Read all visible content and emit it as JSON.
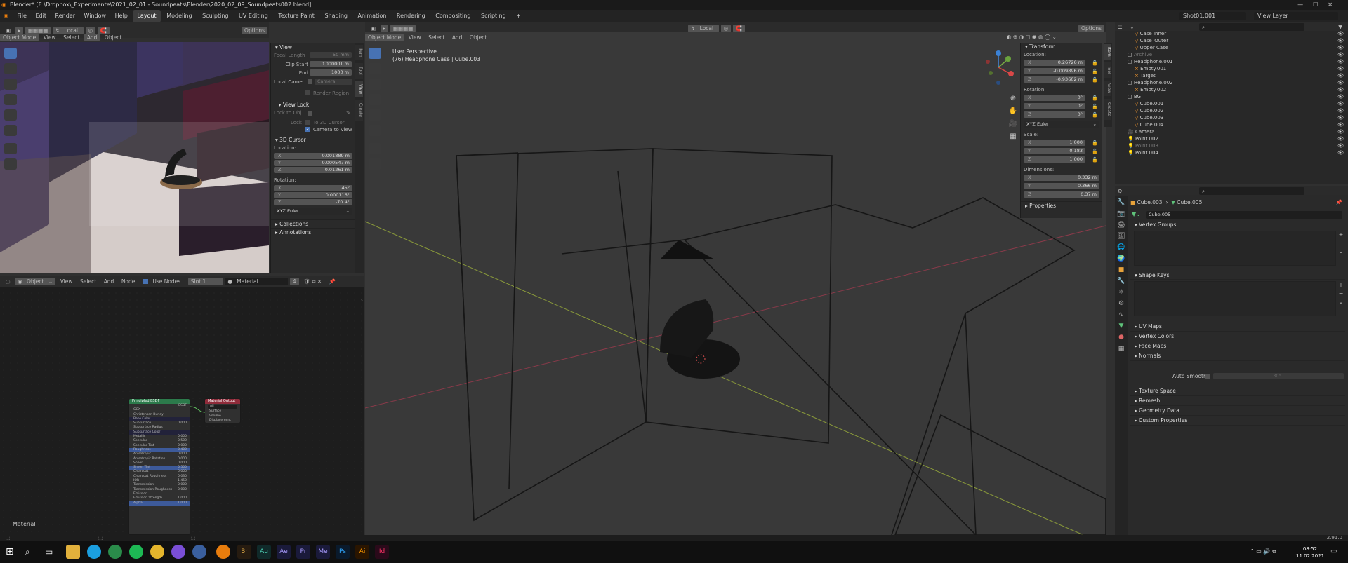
{
  "title": "Blender* [E:\\Dropbox\\_Experimente\\2021_02_01 - Soundpeats\\Blender\\2020_02_09_Soundpeats002.blend]",
  "menu": [
    "File",
    "Edit",
    "Render",
    "Window",
    "Help"
  ],
  "workspaces": [
    "Layout",
    "Modeling",
    "Sculpting",
    "UV Editing",
    "Texture Paint",
    "Shading",
    "Animation",
    "Rendering",
    "Compositing",
    "Scripting"
  ],
  "active_workspace": "Layout",
  "scene": "Shot01.001",
  "view_layer": "View Layer",
  "left_viewport": {
    "mode": "Object Mode",
    "menu": [
      "View",
      "Select",
      "Add",
      "Object"
    ],
    "orientation": "Local",
    "options": "Options",
    "npanel": {
      "view_header": "View",
      "focal_length_label": "Focal Length",
      "focal_length": "50 mm",
      "clip_start_label": "Clip Start",
      "clip_start": "0.000001 m",
      "end_label": "End",
      "end": "1000 m",
      "local_camera_label": "Local Came...",
      "local_camera_value": "Camera",
      "render_region": "Render Region",
      "view_lock_header": "View Lock",
      "lock_to_obj": "Lock to Obj...",
      "lock_label": "Lock",
      "to_3d_cursor": "To 3D Cursor",
      "camera_to_view": "Camera to View",
      "cursor_header": "3D Cursor",
      "location_label": "Location:",
      "loc_x": "-0.001889 m",
      "loc_y": "0.000547 m",
      "loc_z": "0.01261 m",
      "rotation_label": "Rotation:",
      "rot_x": "45°",
      "rot_y": "0.000116°",
      "rot_z": "-70.4°",
      "rot_mode": "XYZ Euler",
      "collections": "Collections",
      "annotations": "Annotations",
      "tabs": [
        "Item",
        "Tool",
        "View",
        "Create"
      ]
    }
  },
  "node_editor": {
    "type": "Object",
    "menu": [
      "View",
      "Select",
      "Add",
      "Node"
    ],
    "use_nodes": "Use Nodes",
    "slot": "Slot 1",
    "material": "Material",
    "users": "4",
    "corner_label": "Material",
    "bsdf": {
      "title": "Principled BSDF",
      "out": "BSDF",
      "rows": [
        "GGX",
        "Christensen-Burley",
        "Base Color",
        "Subsurface",
        "Subsurface Radius",
        "Subsurface Color",
        "Metallic",
        "Specular",
        "Specular Tint",
        "Roughness",
        "Anisotropic",
        "Anisotropic Rotation",
        "Sheen",
        "Sheen Tint",
        "Clearcoat",
        "Clearcoat Roughness",
        "IOR",
        "Transmission",
        "Transmission Roughness",
        "Emission",
        "Emission Strength",
        "Alpha"
      ],
      "vals": [
        "",
        "",
        "",
        "0.000",
        "",
        "",
        "0.000",
        "0.500",
        "0.000",
        "0.400",
        "0.000",
        "0.000",
        "0.000",
        "0.500",
        "0.000",
        "0.030",
        "1.450",
        "0.000",
        "0.000",
        "",
        "1.000",
        "1.000"
      ]
    },
    "output": {
      "title": "Material Output",
      "target": "All",
      "rows": [
        "Surface",
        "Volume",
        "Displacement"
      ]
    }
  },
  "main_viewport": {
    "mode": "Object Mode",
    "menu": [
      "View",
      "Select",
      "Add",
      "Object"
    ],
    "orientation": "Local",
    "options": "Options",
    "info_line1": "User Perspective",
    "info_line2": "(76) Headphone Case | Cube.003",
    "tabs": [
      "Item",
      "Tool",
      "View",
      "Create"
    ],
    "transform": {
      "header": "Transform",
      "location_label": "Location:",
      "loc": [
        "0.26726 m",
        "-0.009896 m",
        "-0.93602 m"
      ],
      "rotation_label": "Rotation:",
      "rot": [
        "0°",
        "0°",
        "0°"
      ],
      "rot_mode": "XYZ Euler",
      "scale_label": "Scale:",
      "scale": [
        "1.000",
        "0.183",
        "1.000"
      ],
      "dimensions_label": "Dimensions:",
      "dim": [
        "0.332 m",
        "0.366 m",
        "0.37 m"
      ],
      "properties": "Properties"
    }
  },
  "outliner": {
    "items": [
      {
        "name": "Case Inner",
        "indent": 2,
        "icon": "mesh"
      },
      {
        "name": "Case_Outer",
        "indent": 2,
        "icon": "mesh"
      },
      {
        "name": "Upper Case",
        "indent": 2,
        "icon": "mesh"
      },
      {
        "name": "Archive",
        "indent": 1,
        "icon": "collection",
        "dim": true
      },
      {
        "name": "Headphone.001",
        "indent": 1,
        "icon": "collection"
      },
      {
        "name": "Empty.001",
        "indent": 2,
        "icon": "empty"
      },
      {
        "name": "Target",
        "indent": 2,
        "icon": "empty"
      },
      {
        "name": "Headphone.002",
        "indent": 1,
        "icon": "collection"
      },
      {
        "name": "Empty.002",
        "indent": 2,
        "icon": "empty"
      },
      {
        "name": "BG",
        "indent": 1,
        "icon": "collection"
      },
      {
        "name": "Cube.001",
        "indent": 2,
        "icon": "mesh"
      },
      {
        "name": "Cube.002",
        "indent": 2,
        "icon": "mesh"
      },
      {
        "name": "Cube.003",
        "indent": 2,
        "icon": "mesh"
      },
      {
        "name": "Cube.004",
        "indent": 2,
        "icon": "mesh"
      },
      {
        "name": "Camera",
        "indent": 1,
        "icon": "camera"
      },
      {
        "name": "Point.002",
        "indent": 1,
        "icon": "light"
      },
      {
        "name": "Point.003",
        "indent": 1,
        "icon": "light",
        "dim": true
      },
      {
        "name": "Point.004",
        "indent": 1,
        "icon": "light"
      }
    ]
  },
  "properties": {
    "breadcrumb_obj": "Cube.003",
    "breadcrumb_data": "Cube.005",
    "mesh_name": "Cube.005",
    "vertex_groups": "Vertex Groups",
    "shape_keys": "Shape Keys",
    "sections": [
      "UV Maps",
      "Vertex Colors",
      "Face Maps",
      "Normals"
    ],
    "auto_smooth": "Auto Smooth",
    "auto_smooth_angle": "30°",
    "sections2": [
      "Texture Space",
      "Remesh",
      "Geometry Data",
      "Custom Properties"
    ]
  },
  "status": {
    "version": "2.91.0"
  },
  "taskbar": {
    "time": "08:52",
    "date": "11.02.2021"
  },
  "colors": {
    "accent": "#4772b3",
    "selected": "#ff9e2e",
    "bg": "#303030"
  }
}
